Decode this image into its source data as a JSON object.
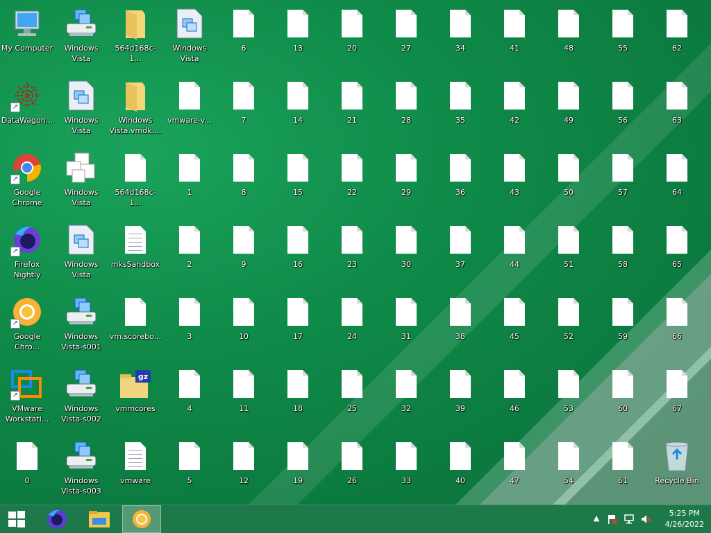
{
  "desktop": {
    "icons": [
      {
        "label": "My Computer",
        "icon": "my-computer-icon",
        "kind": "computer",
        "col": 0,
        "row": 0
      },
      {
        "label": "DataWagon...",
        "icon": "datawagon-icon",
        "kind": "datawagon",
        "col": 0,
        "row": 1,
        "shortcut": true
      },
      {
        "label": "Google Chrome",
        "icon": "chrome-icon",
        "kind": "chrome",
        "col": 0,
        "row": 2,
        "shortcut": true
      },
      {
        "label": "Firefox Nightly",
        "icon": "firefox-nightly-icon",
        "kind": "firefox",
        "col": 0,
        "row": 3,
        "shortcut": true
      },
      {
        "label": "Google Chro...",
        "icon": "chrome-canary-icon",
        "kind": "canary",
        "col": 0,
        "row": 4,
        "shortcut": true
      },
      {
        "label": "VMware Workstati...",
        "icon": "vmware-icon",
        "kind": "vmware",
        "col": 0,
        "row": 5,
        "shortcut": true
      },
      {
        "label": "0",
        "icon": "file-icon",
        "kind": "doc",
        "col": 0,
        "row": 6
      },
      {
        "label": "Windows Vista",
        "icon": "vm-printer-icon",
        "kind": "vmprinter",
        "col": 1,
        "row": 0
      },
      {
        "label": "Windows Vista",
        "icon": "vmx-file-icon",
        "kind": "vmx",
        "col": 1,
        "row": 1
      },
      {
        "label": "Windows Vista",
        "icon": "vm-team-icon",
        "kind": "vmteam",
        "col": 1,
        "row": 2
      },
      {
        "label": "Windows Vista",
        "icon": "vmx-file-icon",
        "kind": "vmx",
        "col": 1,
        "row": 3
      },
      {
        "label": "Windows Vista-s001",
        "icon": "vm-printer-icon",
        "kind": "vmprinter",
        "col": 1,
        "row": 4
      },
      {
        "label": "Windows Vista-s002",
        "icon": "vm-printer-icon",
        "kind": "vmprinter",
        "col": 1,
        "row": 5
      },
      {
        "label": "Windows Vista-s003",
        "icon": "vm-printer-icon",
        "kind": "vmprinter",
        "col": 1,
        "row": 6
      },
      {
        "label": "564d168c-1...",
        "icon": "folder-icon",
        "kind": "folder",
        "col": 2,
        "row": 0
      },
      {
        "label": "Windows Vista.vmdk....",
        "icon": "folder-icon",
        "kind": "folder",
        "col": 2,
        "row": 1
      },
      {
        "label": "564d168c-1...",
        "icon": "file-icon",
        "kind": "doc",
        "col": 2,
        "row": 2
      },
      {
        "label": "mksSandbox",
        "icon": "text-file-icon",
        "kind": "txt",
        "col": 2,
        "row": 3
      },
      {
        "label": "vm.scorebo...",
        "icon": "file-icon",
        "kind": "doc",
        "col": 2,
        "row": 4
      },
      {
        "label": "vmmcores",
        "icon": "gz-archive-icon",
        "kind": "gz",
        "col": 2,
        "row": 5
      },
      {
        "label": "vmware",
        "icon": "text-file-icon",
        "kind": "txt",
        "col": 2,
        "row": 6
      },
      {
        "label": "Windows Vista",
        "icon": "vmx-file-icon",
        "kind": "vmx",
        "col": 3,
        "row": 0
      },
      {
        "label": "vmware-v...",
        "icon": "file-icon",
        "kind": "doc",
        "col": 3,
        "row": 1
      },
      {
        "label": "1",
        "kind": "doc",
        "col": 3,
        "row": 2,
        "icon": "file-icon"
      },
      {
        "label": "2",
        "kind": "doc",
        "col": 3,
        "row": 3,
        "icon": "file-icon"
      },
      {
        "label": "3",
        "kind": "doc",
        "col": 3,
        "row": 4,
        "icon": "file-icon"
      },
      {
        "label": "4",
        "kind": "doc",
        "col": 3,
        "row": 5,
        "icon": "file-icon"
      },
      {
        "label": "5",
        "kind": "doc",
        "col": 3,
        "row": 6,
        "icon": "file-icon"
      },
      {
        "label": "6",
        "kind": "doc",
        "col": 4,
        "row": 0,
        "icon": "file-icon"
      },
      {
        "label": "7",
        "kind": "doc",
        "col": 4,
        "row": 1,
        "icon": "file-icon"
      },
      {
        "label": "8",
        "kind": "doc",
        "col": 4,
        "row": 2,
        "icon": "file-icon"
      },
      {
        "label": "9",
        "kind": "doc",
        "col": 4,
        "row": 3,
        "icon": "file-icon"
      },
      {
        "label": "10",
        "kind": "doc",
        "col": 4,
        "row": 4,
        "icon": "file-icon"
      },
      {
        "label": "11",
        "kind": "doc",
        "col": 4,
        "row": 5,
        "icon": "file-icon"
      },
      {
        "label": "12",
        "kind": "doc",
        "col": 4,
        "row": 6,
        "icon": "file-icon"
      },
      {
        "label": "13",
        "kind": "doc",
        "col": 5,
        "row": 0,
        "icon": "file-icon"
      },
      {
        "label": "14",
        "kind": "doc",
        "col": 5,
        "row": 1,
        "icon": "file-icon"
      },
      {
        "label": "15",
        "kind": "doc",
        "col": 5,
        "row": 2,
        "icon": "file-icon"
      },
      {
        "label": "16",
        "kind": "doc",
        "col": 5,
        "row": 3,
        "icon": "file-icon"
      },
      {
        "label": "17",
        "kind": "doc",
        "col": 5,
        "row": 4,
        "icon": "file-icon"
      },
      {
        "label": "18",
        "kind": "doc",
        "col": 5,
        "row": 5,
        "icon": "file-icon"
      },
      {
        "label": "19",
        "kind": "doc",
        "col": 5,
        "row": 6,
        "icon": "file-icon"
      },
      {
        "label": "20",
        "kind": "doc",
        "col": 6,
        "row": 0,
        "icon": "file-icon"
      },
      {
        "label": "21",
        "kind": "doc",
        "col": 6,
        "row": 1,
        "icon": "file-icon"
      },
      {
        "label": "22",
        "kind": "doc",
        "col": 6,
        "row": 2,
        "icon": "file-icon"
      },
      {
        "label": "23",
        "kind": "doc",
        "col": 6,
        "row": 3,
        "icon": "file-icon"
      },
      {
        "label": "24",
        "kind": "doc",
        "col": 6,
        "row": 4,
        "icon": "file-icon"
      },
      {
        "label": "25",
        "kind": "doc",
        "col": 6,
        "row": 5,
        "icon": "file-icon"
      },
      {
        "label": "26",
        "kind": "doc",
        "col": 6,
        "row": 6,
        "icon": "file-icon"
      },
      {
        "label": "27",
        "kind": "doc",
        "col": 7,
        "row": 0,
        "icon": "file-icon"
      },
      {
        "label": "28",
        "kind": "doc",
        "col": 7,
        "row": 1,
        "icon": "file-icon"
      },
      {
        "label": "29",
        "kind": "doc",
        "col": 7,
        "row": 2,
        "icon": "file-icon"
      },
      {
        "label": "30",
        "kind": "doc",
        "col": 7,
        "row": 3,
        "icon": "file-icon"
      },
      {
        "label": "31",
        "kind": "doc",
        "col": 7,
        "row": 4,
        "icon": "file-icon"
      },
      {
        "label": "32",
        "kind": "doc",
        "col": 7,
        "row": 5,
        "icon": "file-icon"
      },
      {
        "label": "33",
        "kind": "doc",
        "col": 7,
        "row": 6,
        "icon": "file-icon"
      },
      {
        "label": "34",
        "kind": "doc",
        "col": 8,
        "row": 0,
        "icon": "file-icon"
      },
      {
        "label": "35",
        "kind": "doc",
        "col": 8,
        "row": 1,
        "icon": "file-icon"
      },
      {
        "label": "36",
        "kind": "doc",
        "col": 8,
        "row": 2,
        "icon": "file-icon"
      },
      {
        "label": "37",
        "kind": "doc",
        "col": 8,
        "row": 3,
        "icon": "file-icon"
      },
      {
        "label": "38",
        "kind": "doc",
        "col": 8,
        "row": 4,
        "icon": "file-icon"
      },
      {
        "label": "39",
        "kind": "doc",
        "col": 8,
        "row": 5,
        "icon": "file-icon"
      },
      {
        "label": "40",
        "kind": "doc",
        "col": 8,
        "row": 6,
        "icon": "file-icon"
      },
      {
        "label": "41",
        "kind": "doc",
        "col": 9,
        "row": 0,
        "icon": "file-icon"
      },
      {
        "label": "42",
        "kind": "doc",
        "col": 9,
        "row": 1,
        "icon": "file-icon"
      },
      {
        "label": "43",
        "kind": "doc",
        "col": 9,
        "row": 2,
        "icon": "file-icon"
      },
      {
        "label": "44",
        "kind": "doc",
        "col": 9,
        "row": 3,
        "icon": "file-icon"
      },
      {
        "label": "45",
        "kind": "doc",
        "col": 9,
        "row": 4,
        "icon": "file-icon"
      },
      {
        "label": "46",
        "kind": "doc",
        "col": 9,
        "row": 5,
        "icon": "file-icon"
      },
      {
        "label": "47",
        "kind": "doc",
        "col": 9,
        "row": 6,
        "icon": "file-icon"
      },
      {
        "label": "48",
        "kind": "doc",
        "col": 10,
        "row": 0,
        "icon": "file-icon"
      },
      {
        "label": "49",
        "kind": "doc",
        "col": 10,
        "row": 1,
        "icon": "file-icon"
      },
      {
        "label": "50",
        "kind": "doc",
        "col": 10,
        "row": 2,
        "icon": "file-icon"
      },
      {
        "label": "51",
        "kind": "doc",
        "col": 10,
        "row": 3,
        "icon": "file-icon"
      },
      {
        "label": "52",
        "kind": "doc",
        "col": 10,
        "row": 4,
        "icon": "file-icon"
      },
      {
        "label": "53",
        "kind": "doc",
        "col": 10,
        "row": 5,
        "icon": "file-icon"
      },
      {
        "label": "54",
        "kind": "doc",
        "col": 10,
        "row": 6,
        "icon": "file-icon"
      },
      {
        "label": "55",
        "kind": "doc",
        "col": 11,
        "row": 0,
        "icon": "file-icon"
      },
      {
        "label": "56",
        "kind": "doc",
        "col": 11,
        "row": 1,
        "icon": "file-icon"
      },
      {
        "label": "57",
        "kind": "doc",
        "col": 11,
        "row": 2,
        "icon": "file-icon"
      },
      {
        "label": "58",
        "kind": "doc",
        "col": 11,
        "row": 3,
        "icon": "file-icon"
      },
      {
        "label": "59",
        "kind": "doc",
        "col": 11,
        "row": 4,
        "icon": "file-icon"
      },
      {
        "label": "60",
        "kind": "doc",
        "col": 11,
        "row": 5,
        "icon": "file-icon"
      },
      {
        "label": "61",
        "kind": "doc",
        "col": 11,
        "row": 6,
        "icon": "file-icon"
      },
      {
        "label": "62",
        "kind": "doc",
        "col": 12,
        "row": 0,
        "icon": "file-icon"
      },
      {
        "label": "63",
        "kind": "doc",
        "col": 12,
        "row": 1,
        "icon": "file-icon"
      },
      {
        "label": "64",
        "kind": "doc",
        "col": 12,
        "row": 2,
        "icon": "file-icon"
      },
      {
        "label": "65",
        "kind": "doc",
        "col": 12,
        "row": 3,
        "icon": "file-icon"
      },
      {
        "label": "66",
        "kind": "doc",
        "col": 12,
        "row": 4,
        "icon": "file-icon"
      },
      {
        "label": "67",
        "kind": "doc",
        "col": 12,
        "row": 5,
        "icon": "file-icon"
      },
      {
        "label": "Recycle Bin",
        "icon": "recycle-bin-icon",
        "kind": "recycle",
        "col": 12,
        "row": 6
      }
    ]
  },
  "taskbar": {
    "start_icon": "windows-start-icon",
    "pinned": [
      {
        "icon": "firefox-nightly-icon",
        "kind": "firefox"
      },
      {
        "icon": "file-explorer-icon",
        "kind": "explorer"
      },
      {
        "icon": "chrome-canary-icon",
        "kind": "canary",
        "active": true
      }
    ],
    "tray": {
      "show_hidden_icon": "chevron-up-icon",
      "action_center_icon": "action-center-flag-icon",
      "network_icon": "network-icon",
      "volume_icon": "volume-muted-icon"
    },
    "clock": {
      "time": "5:25 PM",
      "date": "4/26/2022"
    }
  },
  "colors": {
    "taskbar": "#1e784b",
    "desktop": "#0f8a48"
  }
}
